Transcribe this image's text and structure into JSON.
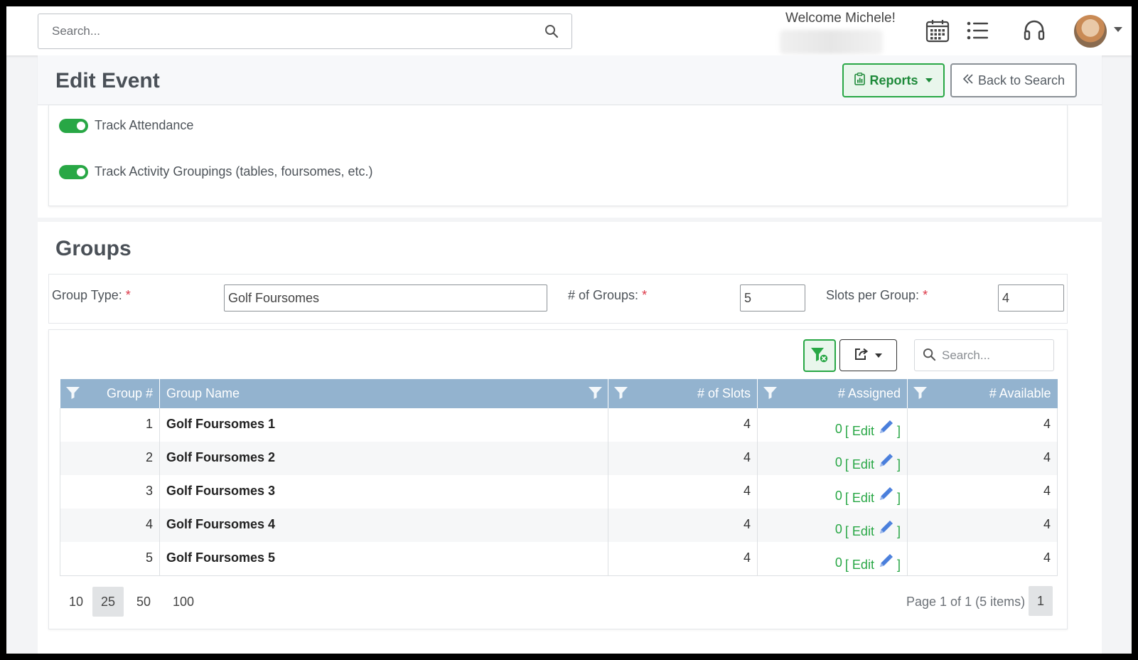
{
  "topbar": {
    "search_placeholder": "Search...",
    "welcome": "Welcome Michele!",
    "icons": [
      "calendar-icon",
      "list-icon",
      "headset-icon"
    ]
  },
  "header": {
    "title": "Edit Event",
    "reports_label": "Reports",
    "back_label": "Back to Search"
  },
  "toggles": {
    "track_attendance": "Track Attendance",
    "track_groupings": "Track Activity Groupings (tables, foursomes, etc.)"
  },
  "groups": {
    "title": "Groups",
    "group_type_label": "Group Type:",
    "group_type_value": "Golf Foursomes",
    "num_groups_label": "# of Groups:",
    "num_groups_value": "5",
    "slots_label": "Slots per Group:",
    "slots_value": "4",
    "required_mark": "*"
  },
  "grid": {
    "search_placeholder": "Search...",
    "columns": [
      "Group #",
      "Group Name",
      "# of Slots",
      "# Assigned",
      "# Available"
    ],
    "rows": [
      {
        "num": "1",
        "name": "Golf Foursomes 1",
        "slots": "4",
        "assigned": "0",
        "available": "4"
      },
      {
        "num": "2",
        "name": "Golf Foursomes 2",
        "slots": "4",
        "assigned": "0",
        "available": "4"
      },
      {
        "num": "3",
        "name": "Golf Foursomes 3",
        "slots": "4",
        "assigned": "0",
        "available": "4"
      },
      {
        "num": "4",
        "name": "Golf Foursomes 4",
        "slots": "4",
        "assigned": "0",
        "available": "4"
      },
      {
        "num": "5",
        "name": "Golf Foursomes 5",
        "slots": "4",
        "assigned": "0",
        "available": "4"
      }
    ],
    "edit_open": "[",
    "edit_label": "Edit",
    "edit_close": "]",
    "page_sizes": [
      "10",
      "25",
      "50",
      "100"
    ],
    "page_size_selected": "25",
    "page_info": "Page 1 of 1 (5 items)",
    "current_page": "1"
  },
  "colors": {
    "accent_green": "#28a745",
    "header_blue": "#93b3cf",
    "edit_icon_blue": "#4a7fdc"
  }
}
